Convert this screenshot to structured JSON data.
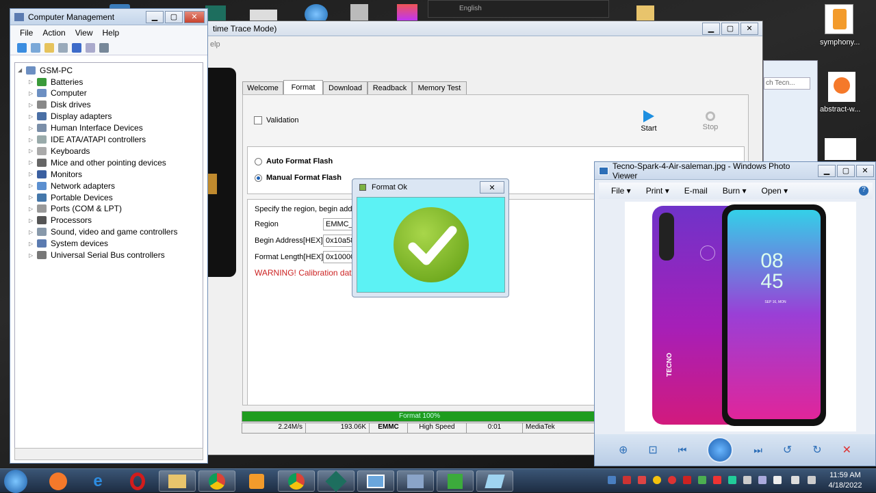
{
  "computer_management": {
    "title": "Computer Management",
    "menu": [
      "File",
      "Action",
      "View",
      "Help"
    ],
    "root": "GSM-PC",
    "devices": [
      "Batteries",
      "Computer",
      "Disk drives",
      "Display adapters",
      "Human Interface Devices",
      "IDE ATA/ATAPI controllers",
      "Keyboards",
      "Mice and other pointing devices",
      "Monitors",
      "Network adapters",
      "Portable Devices",
      "Ports (COM & LPT)",
      "Processors",
      "Sound, video and game controllers",
      "System devices",
      "Universal Serial Bus controllers"
    ]
  },
  "sp_tool": {
    "title_fragment": "time Trace Mode)",
    "menu_fragment": "elp",
    "tabs": [
      "Welcome",
      "Format",
      "Download",
      "Readback",
      "Memory Test"
    ],
    "validation_label": "Validation",
    "start_label": "Start",
    "stop_label": "Stop",
    "auto_format": "Auto Format Flash",
    "manual_format": "Manual Format Flash",
    "specify_text": "Specify the region, begin addres",
    "region_label": "Region",
    "region_value": "EMMC_U",
    "begin_label": "Begin Address[HEX]:",
    "begin_value": "0x10a58",
    "length_label": "Format Length[HEX]:",
    "length_value": "0x10000",
    "warning": "WARNING! Calibration data",
    "progress_text": "Format 100%",
    "progress": 1.0,
    "status": {
      "speed": "2.24M/s",
      "size": "193.06K",
      "storage": "EMMC",
      "mode": "High Speed",
      "time": "0:01",
      "vendor": "MediaTek"
    }
  },
  "format_dialog": {
    "title": "Format Ok"
  },
  "photo_viewer": {
    "title": "Tecno-Spark-4-Air-saleman.jpg - Windows Photo Viewer",
    "menu": [
      "File",
      "Print",
      "E-mail",
      "Burn",
      "Open"
    ],
    "phone_time_h": "08",
    "phone_time_m": "45",
    "phone_date": "SEP 16, MON",
    "brand": "TECNO"
  },
  "desktop": {
    "icons": [
      {
        "label": "symphony..."
      },
      {
        "label": "abstract-w..."
      }
    ],
    "language": "English",
    "search_placeholder": "ch Tecn..."
  },
  "taskbar": {
    "time": "11:59 AM",
    "date": "4/18/2022"
  }
}
